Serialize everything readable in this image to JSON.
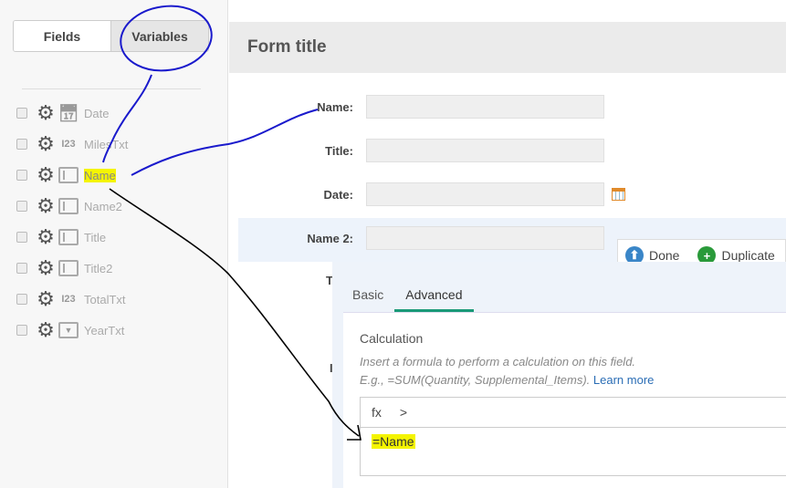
{
  "sidebar": {
    "tabs": [
      {
        "label": "Fields"
      },
      {
        "label": "Variables"
      }
    ],
    "items": [
      {
        "label": "Date",
        "type": "calendar-icon"
      },
      {
        "label": "MilesTxt",
        "type": "number-icon",
        "glyph": "I23"
      },
      {
        "label": "Name",
        "type": "textbox-icon"
      },
      {
        "label": "Name2",
        "type": "textbox-icon"
      },
      {
        "label": "Title",
        "type": "textbox-icon"
      },
      {
        "label": "Title2",
        "type": "textbox-icon"
      },
      {
        "label": "TotalTxt",
        "type": "number-icon",
        "glyph": "I23"
      },
      {
        "label": "YearTxt",
        "type": "dropdown-icon"
      }
    ]
  },
  "form": {
    "title": "Form title",
    "fields": [
      {
        "label": "Name:"
      },
      {
        "label": "Title:"
      },
      {
        "label": "Date:"
      },
      {
        "label": "Name 2:"
      }
    ],
    "hidden_labels": [
      "T",
      "I"
    ]
  },
  "popup": {
    "done": "Done",
    "duplicate": "Duplicate"
  },
  "panel": {
    "tabs": [
      "Basic",
      "Advanced"
    ],
    "calc_title": "Calculation",
    "desc1": "Insert a formula to perform a calculation on this field.",
    "desc2": "E.g., =SUM(Quantity, Supplemental_Items).",
    "learn_more": "Learn more",
    "fx": "fx",
    "chevron": ">",
    "formula": "=Name"
  },
  "colors": {
    "accent": "#1a9a78",
    "done": "#3a86c8",
    "duplicate": "#2a9a3a",
    "highlight": "#f4f400"
  }
}
